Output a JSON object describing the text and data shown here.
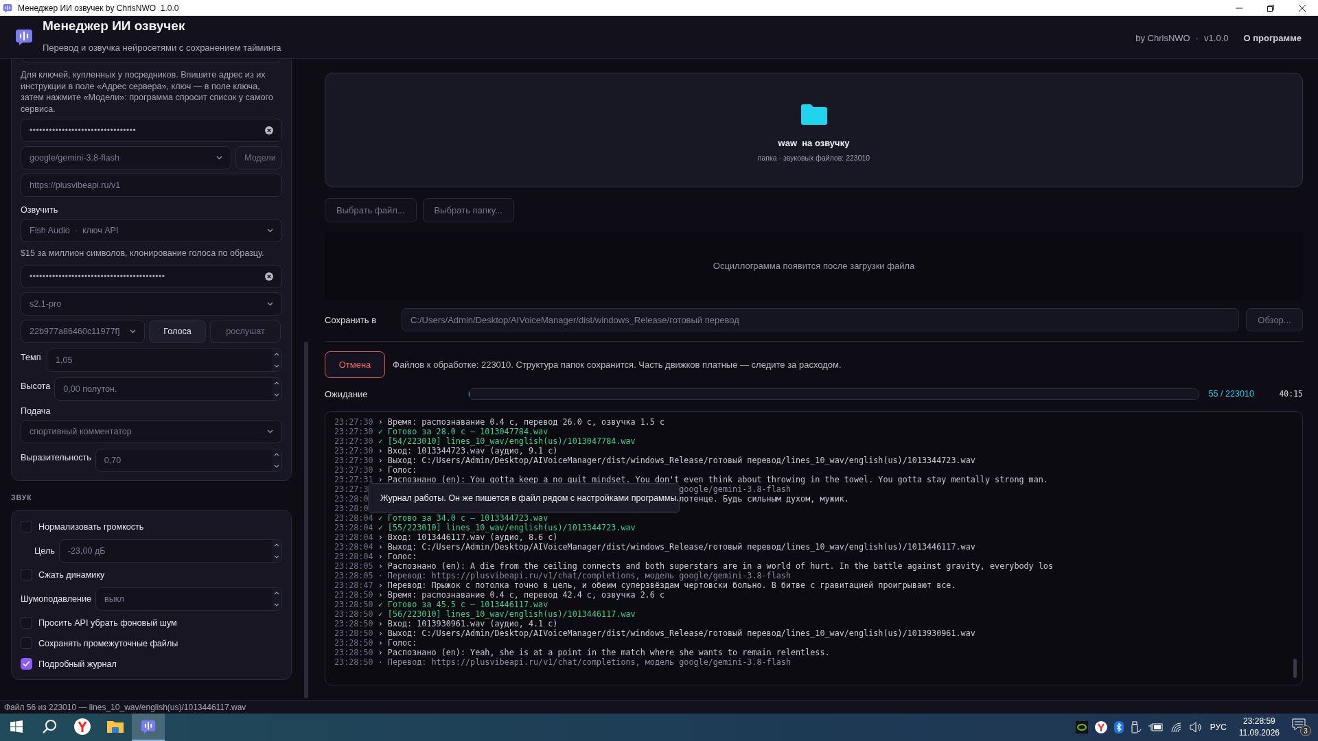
{
  "window": {
    "title": "Менеджер ИИ озвучек by ChrisNWO  1.0.0"
  },
  "header": {
    "title": "Менеджер ИИ озвучек",
    "subtitle": "Перевод и озвучка нейросетями с сохранением тайминга",
    "credit": "by ChrisNWO",
    "separator": "·",
    "version": "v1.0.0",
    "about": "О программе"
  },
  "sidebar": {
    "translate": {
      "hint": "Для ключей, купленных у посредников. Впишите адрес из их инструкции в поле «Адрес сервера», ключ — в поле ключа, затем нажмите «Модели»: программа спросит список у самого сервиса.",
      "key": "•••••••••••••••••••••••••••••••••",
      "model": "google/gemini-3.8-flash",
      "models_button": "Модели",
      "server": "https://plusvibeapi.ru/v1"
    },
    "voice": {
      "label": "Озвучить",
      "engine": "Fish Audio  ·  ключ API",
      "price": "$15 за миллион символов, клонирование голоса по образцу.",
      "key": "••••••••••••••••••••••••••••••••••••••••••",
      "model": "s2.1-pro",
      "voice_id": "22b977a86460c11977f]",
      "voices_button": "Голоса",
      "listen_button": "рослушат",
      "params": [
        {
          "kind": "number",
          "label": "Темп",
          "value": "1,05"
        },
        {
          "kind": "number",
          "label": "Высота",
          "value": "0,00 полутон."
        },
        {
          "kind": "select",
          "label": "Подача",
          "value": "спортивный комментатор"
        },
        {
          "kind": "number",
          "label": "Выразительность",
          "value": "0,70"
        }
      ]
    },
    "sound": {
      "heading": "ЗВУК",
      "items": [
        {
          "kind": "checkbox",
          "label": "Нормализовать громкость",
          "checked": false
        },
        {
          "kind": "subfield",
          "label": "Цель",
          "value": "-23,00 дБ"
        },
        {
          "kind": "checkbox",
          "label": "Сжать динамику",
          "checked": false
        },
        {
          "kind": "number",
          "label": "Шумоподавление",
          "value": "выкл"
        },
        {
          "kind": "checkbox",
          "label": "Просить API убрать фоновый шум",
          "checked": false
        },
        {
          "kind": "checkbox",
          "label": "Сохранять промежуточные файлы",
          "checked": false
        },
        {
          "kind": "checkbox",
          "label": "Подробный журнал",
          "checked": true
        }
      ]
    }
  },
  "dropzone": {
    "title": "waw  на озвучку",
    "subtitle": "папка · звуковых файлов: 223010"
  },
  "pick_buttons": [
    "Выбрать файл...",
    "Выбрать папку..."
  ],
  "waveform": {
    "message": "Осциллограмма появится после загрузки файла"
  },
  "save": {
    "label": "Сохранить в",
    "path": "C:/Users/Admin/Desktop/AIVoiceManager/dist/windows_Release/готовый перевод",
    "browse": "Обзор..."
  },
  "run": {
    "cancel": "Отмена",
    "info": "Файлов к обработке: 223010. Структура папок сохранится. Часть движков платные — следите за расходом."
  },
  "progress": {
    "status": "Ожидание",
    "level": 0.00025,
    "count": "55 / 223010",
    "eta": "40:15"
  },
  "log": {
    "tooltip": "Журнал работы. Он же пишется в файл рядом с настройками программы.",
    "lines": [
      {
        "kind": "info",
        "time": "23:27:30",
        "text": "› Время: распознавание 0.4 с, перевод 26.0 с, озвучка 1.5 с"
      },
      {
        "kind": "ok",
        "time": "23:27:30",
        "text": "✓ Готово за 28.0 с — 1013047784.wav"
      },
      {
        "kind": "ok",
        "time": "23:27:30",
        "text": "✓ [54/223010] lines_10_wav/english(us)/1013047784.wav"
      },
      {
        "kind": "info",
        "time": "23:27:30",
        "text": "› Вход: 1013344723.wav (аудио, 9.1 с)"
      },
      {
        "kind": "info",
        "time": "23:27:30",
        "text": "› Выход: C:/Users/Admin/Desktop/AIVoiceManager/dist/windows_Release/готовый перевод/lines_10_wav/english(us)/1013344723.wav"
      },
      {
        "kind": "info",
        "time": "23:27:30",
        "text": "› Голос:"
      },
      {
        "kind": "info",
        "time": "23:27:31",
        "text": "› Распознано (en): You gotta keep a no quit mindset. You don't even think about throwing in the towel. You gotta stay mentally strong man."
      },
      {
        "kind": "covered-dim",
        "time": "23:27:3",
        "text": "google/gemini-3.8-flash"
      },
      {
        "kind": "covered",
        "time": "23:28:0",
        "text": "лотенце. Будь сильным духом, мужик."
      },
      {
        "kind": "covered",
        "time": "23:28:0"
      },
      {
        "kind": "ok",
        "time": "23:28:04",
        "text": "✓ Готово за 34.0 с — 1013344723.wav"
      },
      {
        "kind": "ok",
        "time": "23:28:04",
        "text": "✓ [55/223010] lines_10_wav/english(us)/1013344723.wav"
      },
      {
        "kind": "info",
        "time": "23:28:04",
        "text": "› Вход: 1013446117.wav (аудио, 8.6 с)"
      },
      {
        "kind": "info",
        "time": "23:28:04",
        "text": "› Выход: C:/Users/Admin/Desktop/AIVoiceManager/dist/windows_Release/готовый перевод/lines_10_wav/english(us)/1013446117.wav"
      },
      {
        "kind": "info",
        "time": "23:28:04",
        "text": "› Голос:"
      },
      {
        "kind": "info",
        "time": "23:28:05",
        "text": "› Распознано (en): A die from the ceiling connects and both superstars are in a world of hurt. In the battle against gravity, everybody los"
      },
      {
        "kind": "dim",
        "time": "23:28:05",
        "text": "· Перевод: https://plusvibeapi.ru/v1/chat/completions, модель google/gemini-3.8-flash"
      },
      {
        "kind": "info",
        "time": "23:28:47",
        "text": "› Перевод: Прыжок с потолка точно в цель, и обеим суперзвёздам чертовски больно. В битве с гравитацией проигрывают все."
      },
      {
        "kind": "info",
        "time": "23:28:50",
        "text": "› Время: распознавание 0.4 с, перевод 42.4 с, озвучка 2.6 с"
      },
      {
        "kind": "ok",
        "time": "23:28:50",
        "text": "✓ Готово за 45.5 с — 1013446117.wav"
      },
      {
        "kind": "ok",
        "time": "23:28:50",
        "text": "✓ [56/223010] lines_10_wav/english(us)/1013446117.wav"
      },
      {
        "kind": "info",
        "time": "23:28:50",
        "text": "› Вход: 1013930961.wav (аудио, 4.1 с)"
      },
      {
        "kind": "info",
        "time": "23:28:50",
        "text": "› Выход: C:/Users/Admin/Desktop/AIVoiceManager/dist/windows_Release/готовый перевод/lines_10_wav/english(us)/1013930961.wav"
      },
      {
        "kind": "info",
        "time": "23:28:50",
        "text": "› Голос:"
      },
      {
        "kind": "info",
        "time": "23:28:50",
        "text": "› Распознано (en): Yeah, she is at a point in the match where she wants to remain relentless."
      },
      {
        "kind": "dim",
        "time": "23:28:50",
        "text": "· Перевод: https://plusvibeapi.ru/v1/chat/completions, модель google/gemini-3.8-flash"
      }
    ]
  },
  "status_bar": {
    "text": "Файл 56 из 223010 — lines_10_wav/english(us)/1013446117.wav"
  },
  "taskbar": {
    "language": "РУС",
    "time": "23:28:59",
    "date": "11.09.2026",
    "notifications": "3"
  }
}
